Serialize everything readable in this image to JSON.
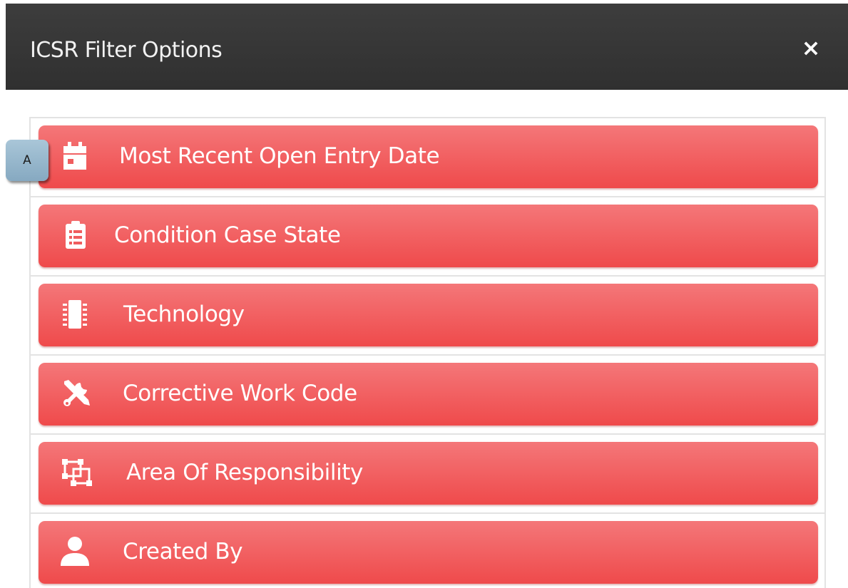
{
  "modal": {
    "title": "ICSR Filter Options",
    "close_label": "×"
  },
  "step_badge": "A",
  "filters": [
    {
      "label": "Most Recent Open Entry Date",
      "icon": "calendar-icon"
    },
    {
      "label": "Condition Case State",
      "icon": "clipboard-list-icon"
    },
    {
      "label": "Technology",
      "icon": "microchip-icon"
    },
    {
      "label": "Corrective Work Code",
      "icon": "tools-icon"
    },
    {
      "label": "Area Of Responsibility",
      "icon": "object-group-icon"
    },
    {
      "label": "Created By",
      "icon": "user-icon"
    }
  ],
  "colors": {
    "header_background": "#353535",
    "filter_button": "#f05d5e",
    "badge": "#97b7cc"
  }
}
